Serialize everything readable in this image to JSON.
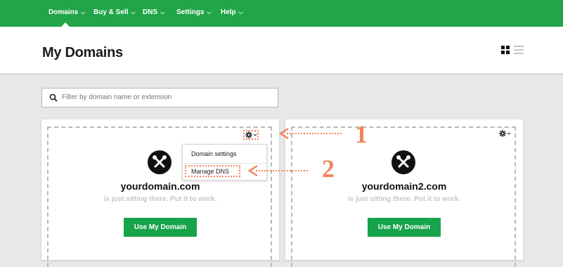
{
  "nav": {
    "items": [
      {
        "label": "Domains"
      },
      {
        "label": "Buy & Sell"
      },
      {
        "label": "DNS"
      },
      {
        "label": "Settings"
      },
      {
        "label": "Help"
      }
    ]
  },
  "header": {
    "title": "My Domains"
  },
  "search": {
    "placeholder": "Filter by domain name or extension"
  },
  "cards": [
    {
      "domain": "yourdomain.com",
      "tagline": "is just sitting there. Put it to work.",
      "button": "Use My Domain"
    },
    {
      "domain": "yourdomain2.com",
      "tagline": "is just sitting there. Put it to work.",
      "button": "Use My Domain"
    }
  ],
  "dropdown": {
    "items": [
      "Domain settings",
      "Manage DNS"
    ]
  },
  "annotations": {
    "step1": "1",
    "step2": "2"
  },
  "colors": {
    "brand_green": "#21a548",
    "button_green": "#16a34a",
    "annotation_orange": "#f3845a"
  }
}
